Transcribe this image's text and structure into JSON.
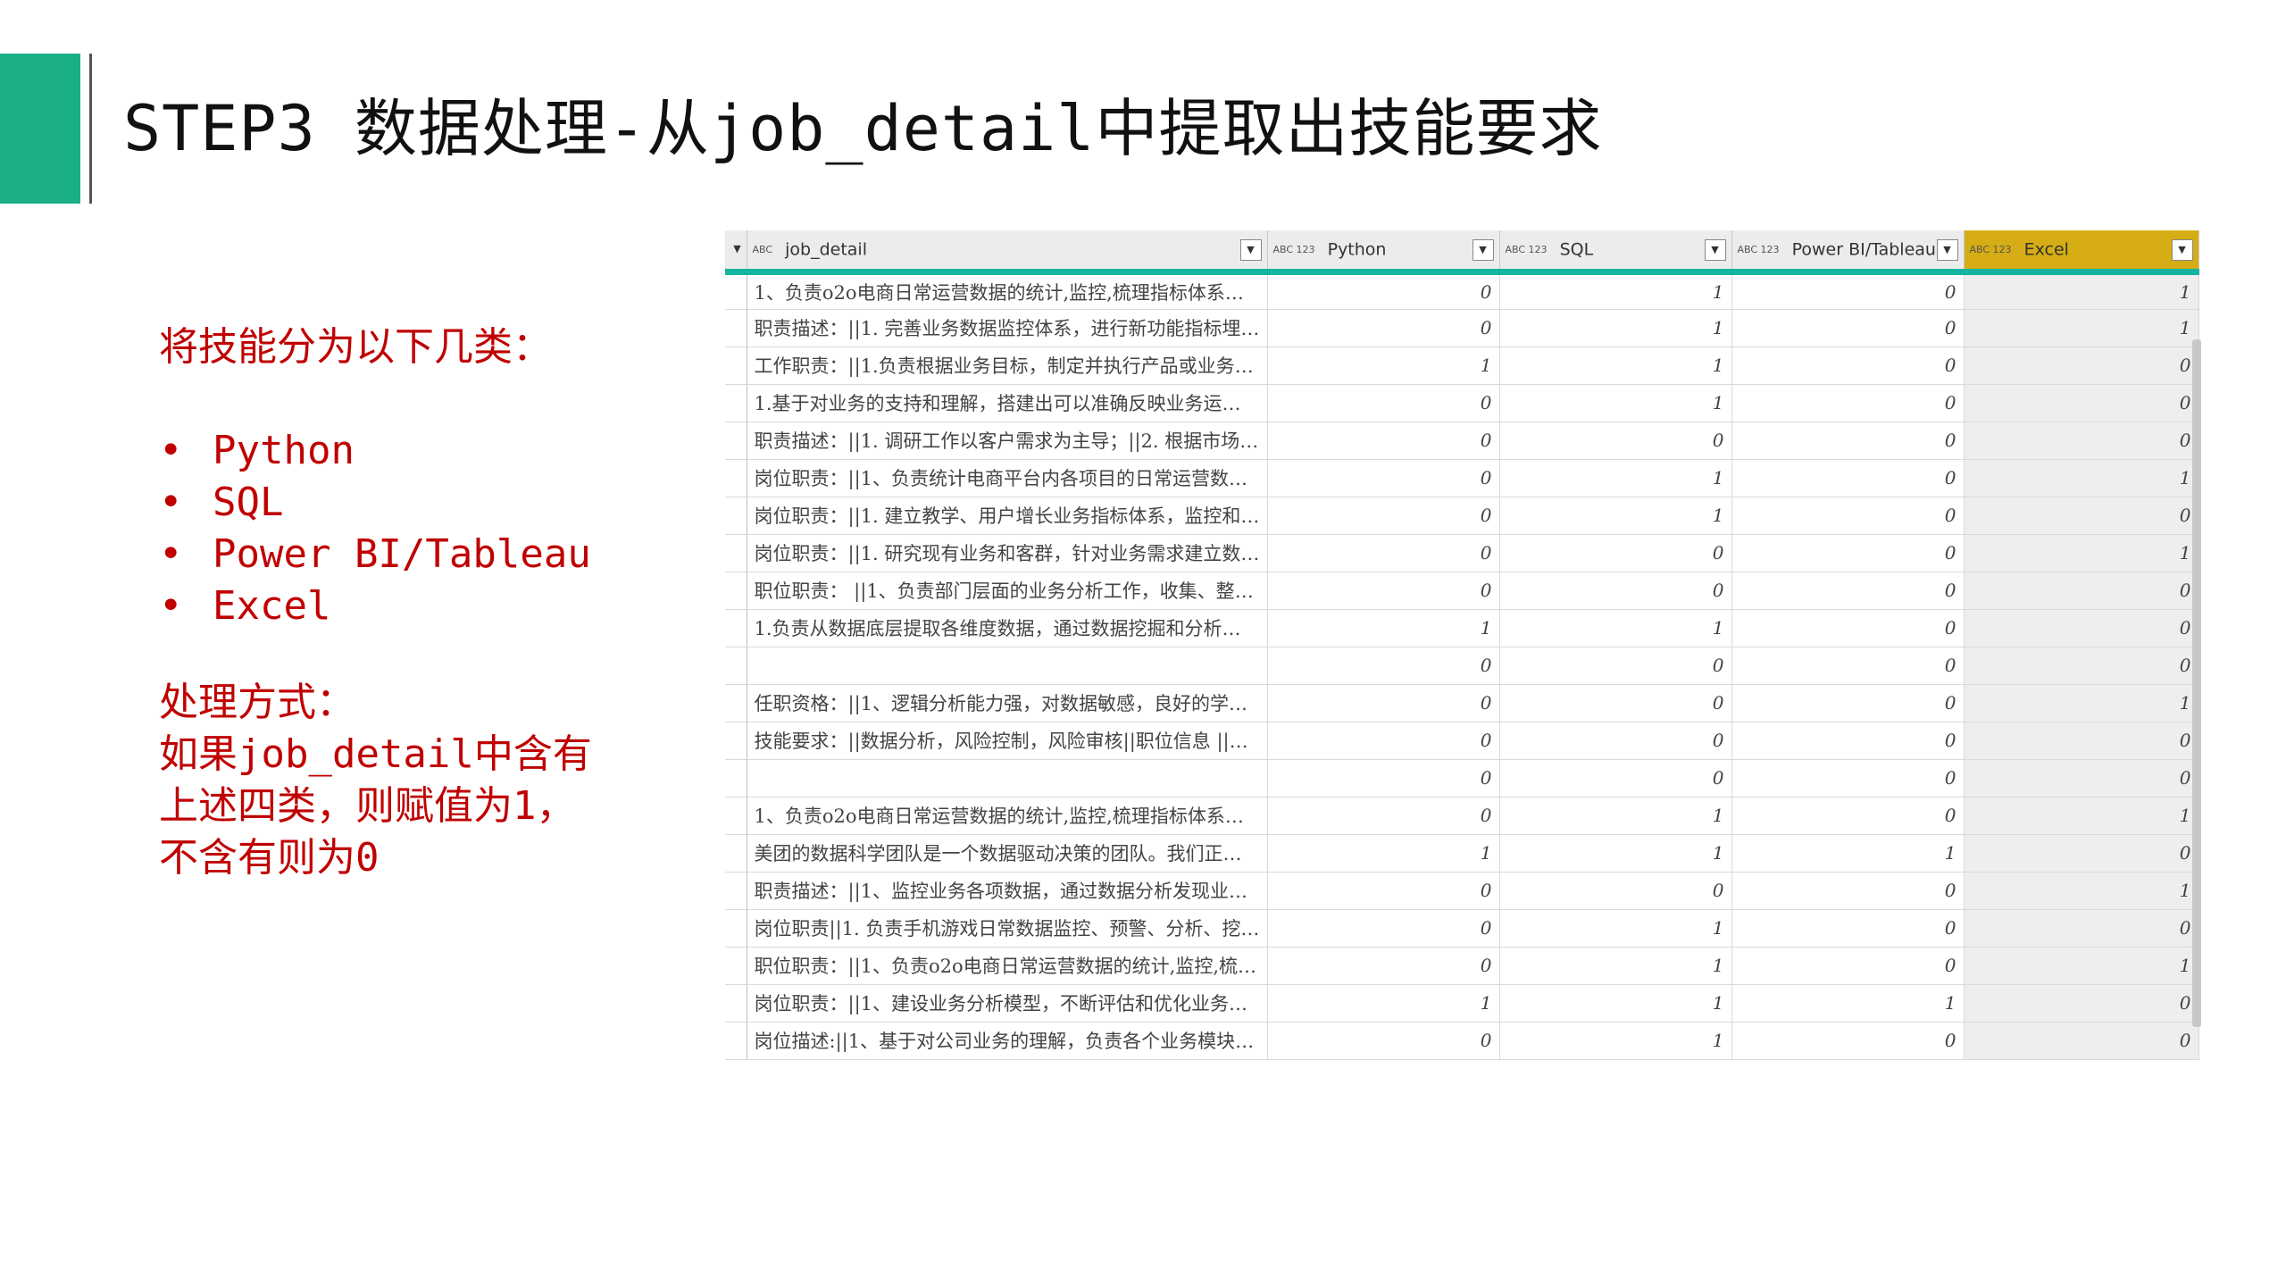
{
  "title": "STEP3 数据处理-从job_detail中提取出技能要求",
  "left_panel": {
    "heading": "将技能分为以下几类：",
    "skills": [
      "Python",
      "SQL",
      "Power BI/Tableau",
      "Excel"
    ],
    "method_lines": [
      "处理方式：",
      "如果job_detail中含有",
      "上述四类，则赋值为1，",
      "不含有则为0"
    ]
  },
  "table": {
    "columns": [
      {
        "label": "job_detail",
        "type_icon": "ABC"
      },
      {
        "label": "Python",
        "type_icon": "ABC 123"
      },
      {
        "label": "SQL",
        "type_icon": "ABC 123"
      },
      {
        "label": "Power BI/Tableau",
        "type_icon": "ABC 123"
      },
      {
        "label": "Excel",
        "type_icon": "ABC 123"
      }
    ],
    "rows": [
      [
        "1、负责o2o电商日常运营数据的统计,监控,梳理指标体系；||2、...",
        "0",
        "1",
        "0",
        "1"
      ],
      [
        "职责描述：||1.  完善业务数据监控体系，进行新功能指标埋点...",
        "0",
        "1",
        "0",
        "1"
      ],
      [
        "工作职责：||1.负责根据业务目标，制定并执行产品或业务的运营...",
        "1",
        "1",
        "0",
        "0"
      ],
      [
        "1.基于对业务的支持和理解，搭建出可以准确反映业务运作状况...",
        "0",
        "1",
        "0",
        "0"
      ],
      [
        "职责描述：||1. 调研工作以客户需求为主导；||2. 根据市场调研...",
        "0",
        "0",
        "0",
        "0"
      ],
      [
        "岗位职责：||1、负责统计电商平台内各项目的日常运营数据及活...",
        "0",
        "1",
        "0",
        "1"
      ],
      [
        "岗位职责：||1. 建立教学、用户增长业务指标体系，监控和分析...",
        "0",
        "1",
        "0",
        "0"
      ],
      [
        "岗位职责：||1. 研究现有业务和客群，针对业务需求建立数据分...",
        "0",
        "0",
        "0",
        "1"
      ],
      [
        "职位职责：  ||1、负责部门层面的业务分析工作，收集、整理和可...",
        "0",
        "0",
        "0",
        "0"
      ],
      [
        "1.负责从数据底层提取各维度数据，通过数据挖掘和分析，为业...",
        "1",
        "1",
        "0",
        "0"
      ],
      [
        "",
        "0",
        "0",
        "0",
        "0"
      ],
      [
        "任职资格：||1、逻辑分析能力强，对数据敏感，良好的学习能力...",
        "0",
        "0",
        "0",
        "1"
      ],
      [
        "技能要求：||数据分析，风险控制，风险审核||职位信息 ||大专...",
        "0",
        "0",
        "0",
        "0"
      ],
      [
        "",
        "0",
        "0",
        "0",
        "0"
      ],
      [
        "1、负责o2o电商日常运营数据的统计,监控,梳理指标体系；||2、...",
        "0",
        "1",
        "0",
        "1"
      ],
      [
        "美团的数据科学团队是一个数据驱动决策的团队。我们正在寻找...",
        "1",
        "1",
        "1",
        "0"
      ],
      [
        "职责描述：||1、监控业务各项数据，通过数据分析发现业务问题...",
        "0",
        "0",
        "0",
        "1"
      ],
      [
        "岗位职责||1. 负责手机游戏日常数据监控、预警、分析、挖掘工...",
        "0",
        "1",
        "0",
        "0"
      ],
      [
        "职位职责：||1、负责o2o电商日常运营数据的统计,监控,梳理指...",
        "0",
        "1",
        "0",
        "1"
      ],
      [
        "岗位职责：||1、建设业务分析模型，不断评估和优化业务分析模...",
        "1",
        "1",
        "1",
        "0"
      ],
      [
        "岗位描述:||1、基于对公司业务的理解，负责各个业务模块的数据...",
        "0",
        "1",
        "0",
        "0"
      ]
    ]
  },
  "colors": {
    "accent": "#1aaf85",
    "text_red": "#c00000",
    "teal_border": "#14b3a2",
    "excel_header": "#d6ad14"
  },
  "icons": {
    "dropdown": "chevron-down-icon",
    "column_type": "type-icon"
  }
}
